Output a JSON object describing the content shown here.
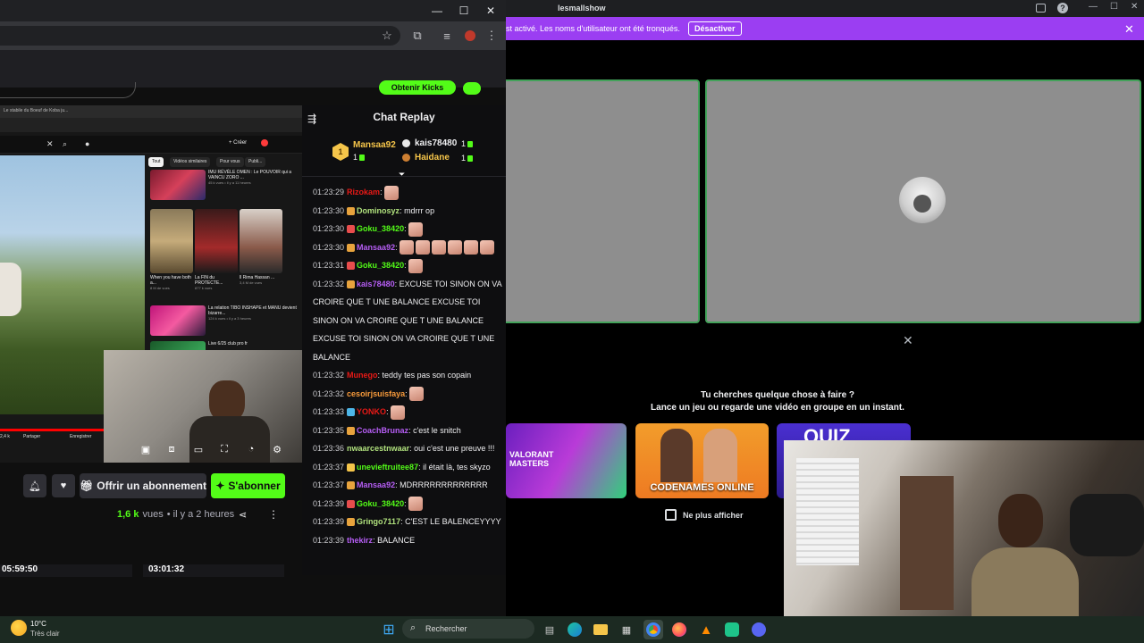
{
  "left_window": {
    "controls": {
      "minimize": "—",
      "maximize": "☐",
      "close": "✕"
    },
    "kicks_button": "Obtenir Kicks",
    "nested": {
      "tab_title": "Le stabile du Boeuf de Koba ju...",
      "chips": [
        "Tout",
        "Vidéos similaires",
        "Pour vous",
        "Publi..."
      ],
      "create_label": "+ Créer",
      "videos": [
        {
          "title": "IMU RÉVÈLE OMEN : Le POUVOIR qui a VAINCU ZORO ...",
          "meta": "45 k vues • il y a 11 heures"
        },
        {
          "title": "When you have both a...",
          "meta": "8 M de vues"
        },
        {
          "title": "La FIN du PROTECTE...",
          "meta": "877 k vues"
        },
        {
          "title": "ll Rima Hassan ...",
          "meta": "3,4 M de vues"
        },
        {
          "title": "La relation TIBO INSHAPE et MANU devient bizarre...",
          "meta": "124 k vues • il y a 3 heures"
        },
        {
          "title": "Live 6/25 club pro fr",
          "meta": ""
        }
      ],
      "share_label": "Partager",
      "save_label": "Enregistrer",
      "count_label": "2,4 k"
    },
    "actions": {
      "gift_label": "Offrir un abonnement",
      "subscribe_label": "S'abonner",
      "views_number": "1,6 k",
      "views_word": "vues",
      "age": "• il y a 2 heures"
    },
    "vods": [
      {
        "duration": "05:59:50"
      },
      {
        "duration": "03:01:32"
      }
    ]
  },
  "chat": {
    "title": "Chat Replay",
    "leaderboard": [
      {
        "rank": "1",
        "name": "Mansaa92",
        "count": "1",
        "color": "#f5c54a"
      },
      {
        "name": "kais78480",
        "count": "1",
        "color": "#efeff1"
      },
      {
        "name": "Haidane",
        "count": "1",
        "color": "#f5c54a"
      }
    ],
    "messages": [
      {
        "time": "01:23:29",
        "user": "Rizokam",
        "color": "#e91916",
        "text": ":",
        "emotes": 1
      },
      {
        "time": "01:23:30",
        "user": "Dominosyz",
        "color": "#b1e27e",
        "text": ": mdrrr op",
        "badge": "#e8a33d"
      },
      {
        "time": "01:23:30",
        "user": "Goku_38420",
        "color": "#53fc18",
        "text": ":",
        "badge": "#e84d4d",
        "emotes": 1
      },
      {
        "time": "01:23:30",
        "user": "Mansaa92",
        "color": "#b65ef5",
        "text": ":",
        "badge": "#e8a33d",
        "emotes": 6
      },
      {
        "time": "01:23:31",
        "user": "Goku_38420",
        "color": "#53fc18",
        "text": ":",
        "badge": "#e84d4d",
        "emotes": 1
      },
      {
        "time": "01:23:32",
        "user": "kais78480",
        "color": "#b65ef5",
        "text": ": EXCUSE TOI SINON ON VA CROIRE QUE T UNE BALANCE EXCUSE TOI SINON ON VA CROIRE QUE T UNE BALANCE EXCUSE TOI SINON ON VA CROIRE QUE T UNE BALANCE",
        "badge": "#e8a33d",
        "wrap": true
      },
      {
        "time": "01:23:32",
        "user": "Munego",
        "color": "#e91916",
        "text": ": teddy tes pas son copain"
      },
      {
        "time": "01:23:32",
        "user": "cesoirjsuisfaya",
        "color": "#f79a3b",
        "text": ":",
        "emotes": 1
      },
      {
        "time": "01:23:33",
        "user": "YONKO",
        "color": "#e91916",
        "text": ":",
        "badge": "#4db6e8",
        "emotes": 1
      },
      {
        "time": "01:23:35",
        "user": "CoachBrunaz",
        "color": "#b65ef5",
        "text": ": c'est le snitch",
        "badge": "#e8a33d"
      },
      {
        "time": "01:23:36",
        "user": "nwaarcestnwaar",
        "color": "#b1e27e",
        "text": ": oui c'est une preuve !!!",
        "wrap": true
      },
      {
        "time": "01:23:37",
        "user": "unevieftruitee87",
        "color": "#53fc18",
        "text": ": il était là, tes skyzo",
        "badge": "#f5c54a",
        "wrap": true
      },
      {
        "time": "01:23:37",
        "user": "Mansaa92",
        "color": "#b65ef5",
        "text": ": MDRRRRRRRRRRRRR",
        "badge": "#e8a33d"
      },
      {
        "time": "01:23:39",
        "user": "Goku_38420",
        "color": "#53fc18",
        "text": ":",
        "badge": "#e84d4d",
        "emotes": 1
      },
      {
        "time": "01:23:39",
        "user": "Gringo7117",
        "color": "#b1e27e",
        "text": ": C'EST LE BALENCEYYYY",
        "badge": "#e8a33d",
        "wrap": true
      },
      {
        "time": "01:23:39",
        "user": "thekirz",
        "color": "#b65ef5",
        "text": ": BALANCE"
      }
    ]
  },
  "discord": {
    "app_title": "lesmallshow",
    "notice_text": "st activé. Les noms d'utilisateur ont été tronqués.",
    "notice_button": "Désactiver",
    "activity_line1": "Tu cherches quelque chose à faire ?",
    "activity_line2": "Lance un jeu ou regarde une vidéo en groupe en un instant.",
    "cards": [
      {
        "title": "VALORANT MASTERS"
      },
      {
        "title": "CODENAMES ONLINE"
      },
      {
        "title": "QUIZ"
      }
    ],
    "no_show_label": "Ne plus afficher"
  },
  "taskbar": {
    "weather_temp": "10°C",
    "weather_desc": "Très clair",
    "search_placeholder": "Rechercher"
  }
}
